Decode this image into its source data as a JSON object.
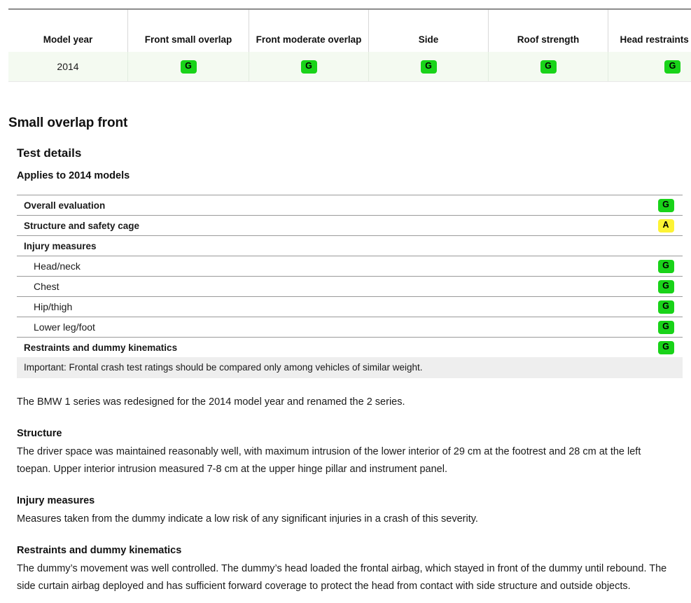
{
  "ratings_table": {
    "columns": [
      "Model year",
      "Front small overlap",
      "Front moderate overlap",
      "Side",
      "Roof strength",
      "Head restraints & seats"
    ],
    "rows": [
      {
        "model_year": "2014",
        "front_small_overlap": "G",
        "front_moderate_overlap": "G",
        "side": "G",
        "roof_strength": "G",
        "head_restraints_seats": "G"
      }
    ]
  },
  "section": {
    "title": "Small overlap front",
    "sub_title": "Test details",
    "applies_to": "Applies to 2014 models"
  },
  "detail_rows": [
    {
      "label": "Overall evaluation",
      "rating": "G",
      "level": 1
    },
    {
      "label": "Structure and safety cage",
      "rating": "A",
      "level": 1
    },
    {
      "label": "Injury measures",
      "rating": "",
      "level": 1
    },
    {
      "label": "Head/neck",
      "rating": "G",
      "level": 2
    },
    {
      "label": "Chest",
      "rating": "G",
      "level": 2
    },
    {
      "label": "Hip/thigh",
      "rating": "G",
      "level": 2
    },
    {
      "label": "Lower leg/foot",
      "rating": "G",
      "level": 2
    },
    {
      "label": "Restraints and dummy kinematics",
      "rating": "G",
      "level": 1
    }
  ],
  "important_note": "Important: Frontal crash test ratings should be compared only among vehicles of similar weight.",
  "body": {
    "intro": "The BMW 1 series was redesigned for the 2014 model year and renamed the 2 series.",
    "sections": [
      {
        "heading": "Structure",
        "text": "The driver space was maintained reasonably well, with maximum intrusion of the lower interior of 29 cm at the footrest and 28 cm at the left toepan. Upper interior intrusion measured 7-8 cm at the upper hinge pillar and instrument panel."
      },
      {
        "heading": "Injury measures",
        "text": "Measures taken from the dummy indicate a low risk of any significant injuries in a crash of this severity."
      },
      {
        "heading": "Restraints and dummy kinematics",
        "text": "The dummy’s movement was well controlled. The dummy’s head loaded the frontal airbag, which stayed in front of the dummy until rebound. The side curtain airbag deployed and has sufficient forward coverage to protect the head from contact with side structure and outside objects."
      }
    ]
  },
  "colors": {
    "rating_good": "#19d319",
    "rating_acceptable": "#fdf334",
    "rating_marginal": "#ffa71a",
    "rating_poor": "#e8271c",
    "row_tint": "#f4faf1",
    "note_bg": "#eeeeee"
  }
}
